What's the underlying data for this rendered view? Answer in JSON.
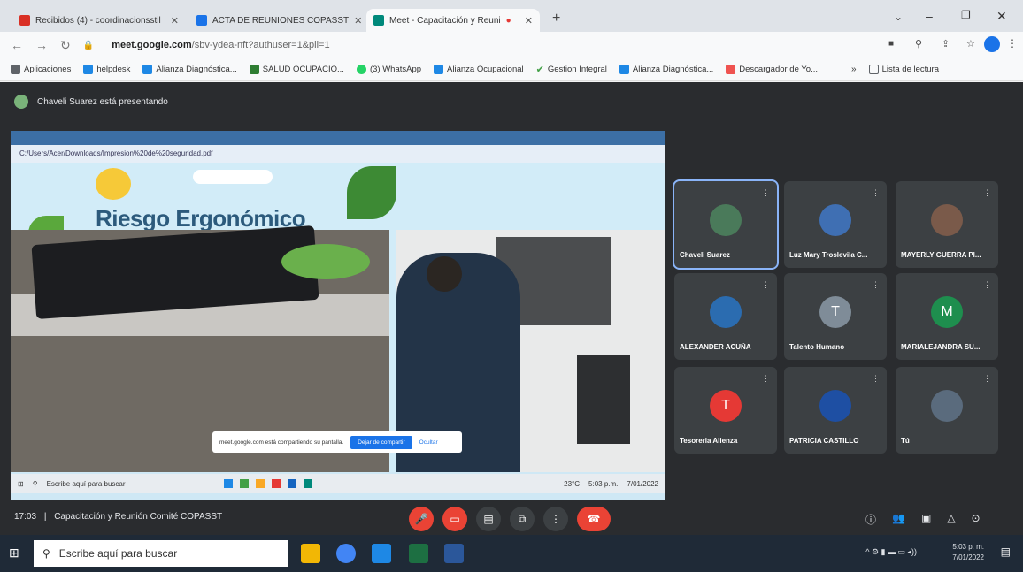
{
  "tabs": [
    {
      "title": "Recibidos (4) - coordinacionsstil",
      "icon": "gmail-icon",
      "color": "#d93025"
    },
    {
      "title": "ACTA DE REUNIONES COPASST",
      "icon": "drive-icon",
      "color": "#1a73e8"
    },
    {
      "title": "Meet - Capacitación y Reuni",
      "icon": "meet-icon",
      "color": "#00897b"
    }
  ],
  "address": {
    "host": "meet.google.com",
    "path": "/sbv-ydea-nft?authuser=1&pli=1"
  },
  "bookmarks": [
    {
      "label": "Aplicaciones",
      "color": "#5f6368"
    },
    {
      "label": "helpdesk",
      "color": "#1e88e5"
    },
    {
      "label": "Alianza Diagnóstica...",
      "color": "#1e88e5"
    },
    {
      "label": "SALUD OCUPACIO...",
      "color": "#2e7d32"
    },
    {
      "label": "(3) WhatsApp",
      "color": "#25d366"
    },
    {
      "label": "Alianza Ocupacional",
      "color": "#1e88e5"
    },
    {
      "label": "Gestion Integral",
      "color": "#43a047"
    },
    {
      "label": "Alianza Diagnóstica...",
      "color": "#1e88e5"
    },
    {
      "label": "Descargador de Yo...",
      "color": "#ef5350"
    },
    {
      "label": "Lista de lectura",
      "color": "#5f6368"
    }
  ],
  "presenter_text": "Chaveli Suarez está presentando",
  "shared_screen": {
    "address": "C:/Users/Acer/Downloads/Impresion%20de%20seguridad.pdf",
    "slide_title": "Riesgo Ergonómico",
    "toast_text": "meet.google.com está compartiendo su pantalla.",
    "toast_stop": "Dejar de compartir",
    "toast_hide": "Ocultar",
    "taskbar_search": "Escribe aquí para buscar",
    "temp": "23°C",
    "time": "5:03 p.m.",
    "date": "7/01/2022"
  },
  "participants": [
    {
      "name": "Chaveli Suarez",
      "initial": "",
      "color": "#4a7a5a",
      "selected": true
    },
    {
      "name": "Luz Mary Troslevila C...",
      "initial": "",
      "color": "#3f6fb3",
      "selected": false
    },
    {
      "name": "MAYERLY GUERRA Pl...",
      "initial": "",
      "color": "#7a5a4a",
      "selected": false
    },
    {
      "name": "ALEXANDER ACUÑA",
      "initial": "",
      "color": "#2b6cb0",
      "selected": false
    },
    {
      "name": "Talento Humano",
      "initial": "T",
      "color": "#7f8c98",
      "selected": false
    },
    {
      "name": "MARIALEJANDRA SU...",
      "initial": "M",
      "color": "#1e8e4e",
      "selected": false
    },
    {
      "name": "Tesoreria Alienza",
      "initial": "T",
      "color": "#e53935",
      "selected": false
    },
    {
      "name": "PATRICIA CASTILLO",
      "initial": "",
      "color": "#1e4fa3",
      "selected": false
    },
    {
      "name": "Tú",
      "initial": "",
      "color": "#5a6b7d",
      "selected": false
    }
  ],
  "meeting": {
    "time": "17:03",
    "title": "Capacitación y Reunión Comité COPASST"
  },
  "taskbar": {
    "search_placeholder": "Escribe aquí para buscar",
    "time": "5:03 p. m.",
    "date": "7/01/2022"
  }
}
